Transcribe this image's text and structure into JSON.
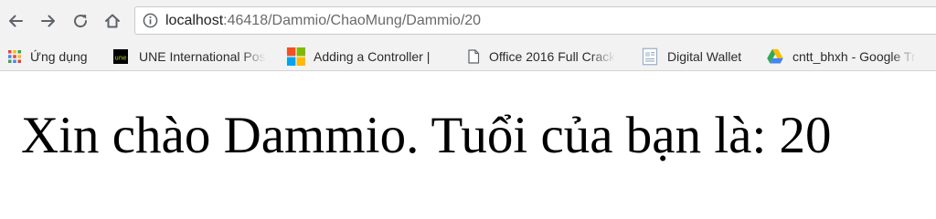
{
  "browser": {
    "address_bar": {
      "host": "localhost",
      "path": ":46418/Dammio/ChaoMung/Dammio/20"
    },
    "bookmarks": [
      {
        "label": "Ứng dụng",
        "icon": "apps-grid-icon"
      },
      {
        "label": "UNE International Pos",
        "icon": "une-logo-icon"
      },
      {
        "label": "Adding a Controller |",
        "icon": "microsoft-logo-icon"
      },
      {
        "label": "Office 2016 Full Crack",
        "icon": "page-icon"
      },
      {
        "label": "Digital Wallet",
        "icon": "document-icon"
      },
      {
        "label": "cntt_bhxh - Google Tr",
        "icon": "google-drive-icon"
      }
    ]
  },
  "page": {
    "heading": "Xin chào Dammio. Tuổi của bạn là: 20"
  },
  "colors": {
    "toolbar_bg": "#f2f2f2",
    "icon_gray": "#5f6368",
    "url_path": "#6a6a6a"
  }
}
